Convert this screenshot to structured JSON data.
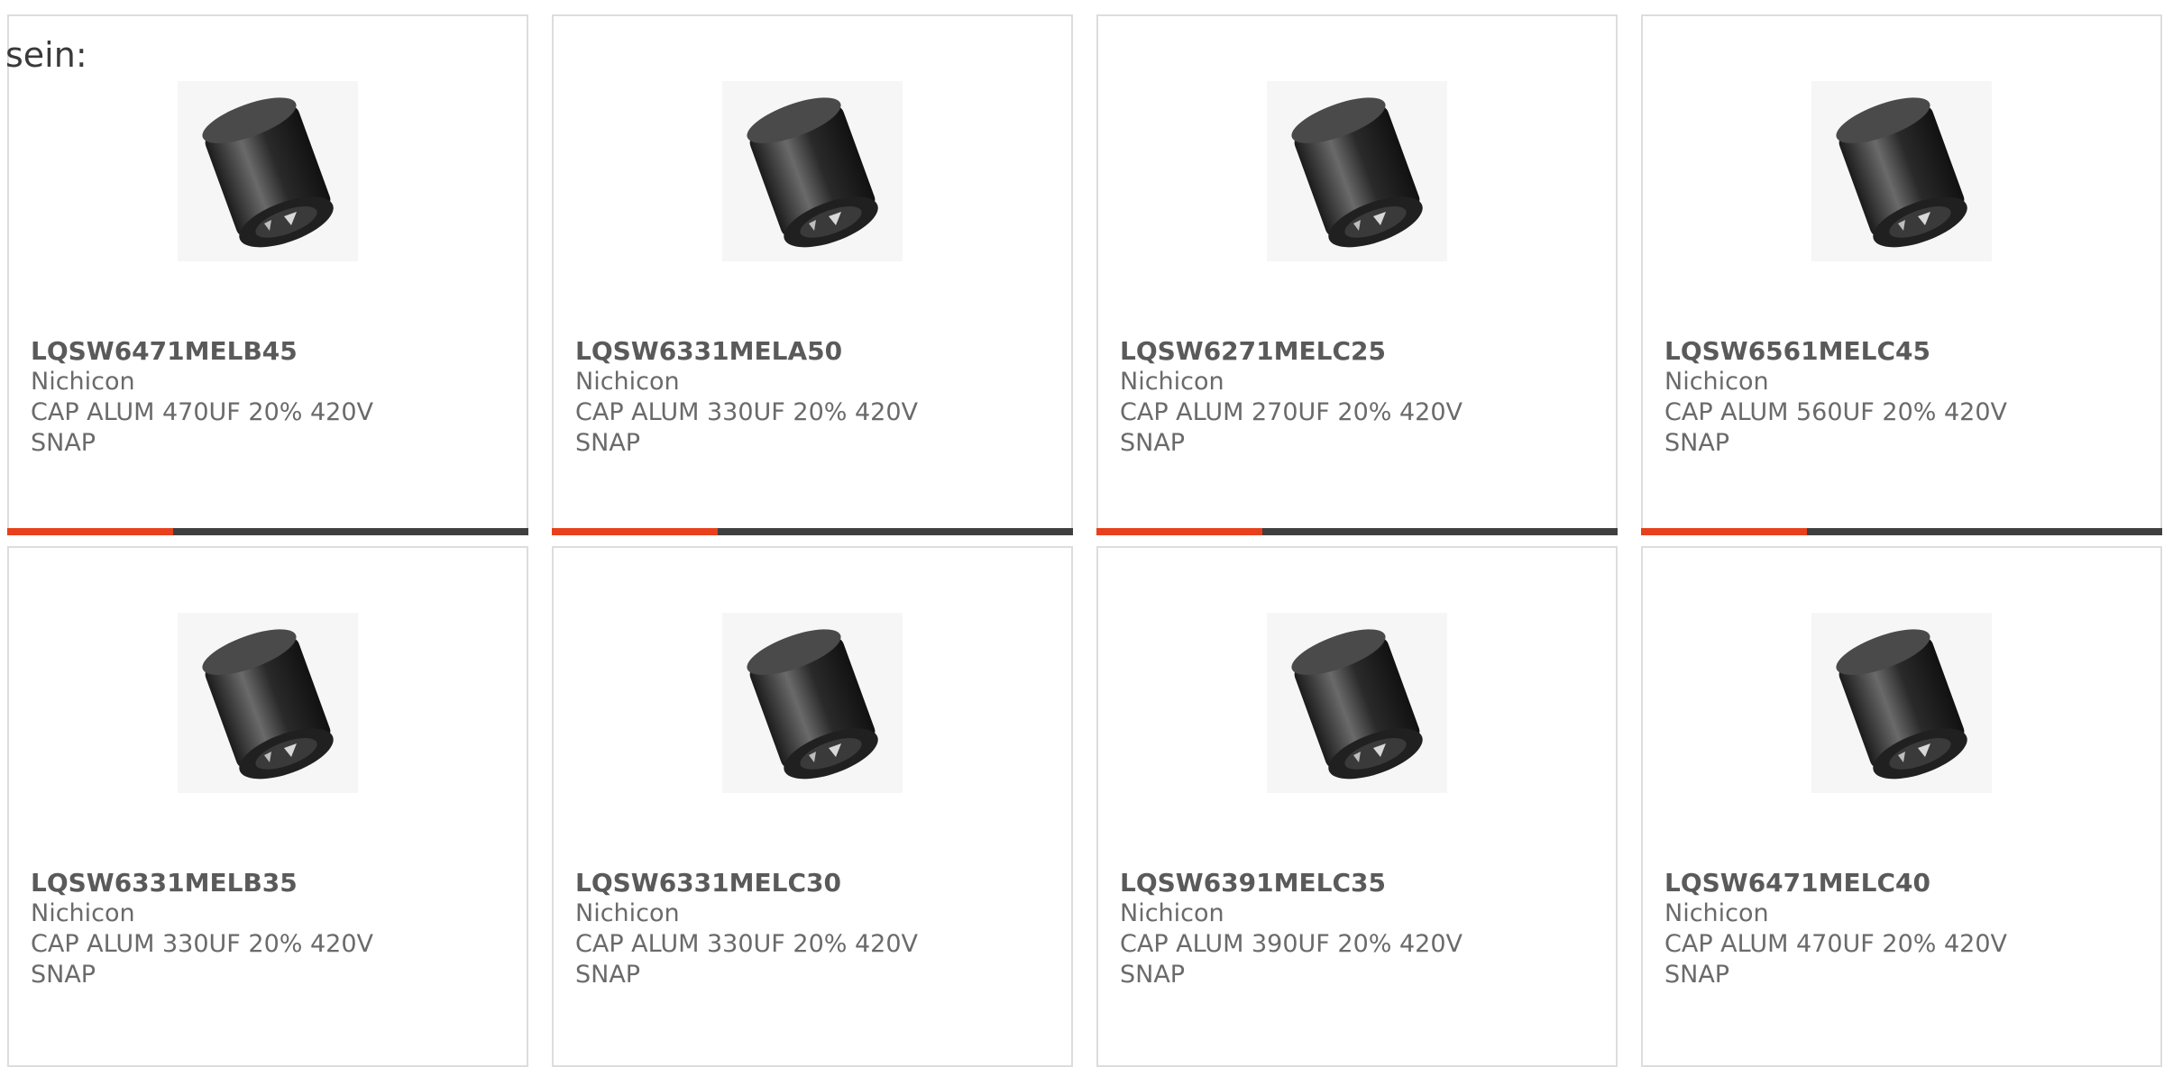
{
  "intro_text": "sein:",
  "colors": {
    "accent": "#e8401c",
    "bar": "#3f3f3f",
    "border": "#dddddd"
  },
  "products": [
    {
      "part": "LQSW6471MELB45",
      "manufacturer": "Nichicon",
      "desc1": "CAP ALUM 470UF 20% 420V",
      "desc2": "SNAP",
      "image": "capacitor-icon"
    },
    {
      "part": "LQSW6331MELA50",
      "manufacturer": "Nichicon",
      "desc1": "CAP ALUM 330UF 20% 420V",
      "desc2": "SNAP",
      "image": "capacitor-icon"
    },
    {
      "part": "LQSW6271MELC25",
      "manufacturer": "Nichicon",
      "desc1": "CAP ALUM 270UF 20% 420V",
      "desc2": "SNAP",
      "image": "capacitor-icon"
    },
    {
      "part": "LQSW6561MELC45",
      "manufacturer": "Nichicon",
      "desc1": "CAP ALUM 560UF 20% 420V",
      "desc2": "SNAP",
      "image": "capacitor-icon"
    },
    {
      "part": "LQSW6331MELB35",
      "manufacturer": "Nichicon",
      "desc1": "CAP ALUM 330UF 20% 420V",
      "desc2": "SNAP",
      "image": "capacitor-icon"
    },
    {
      "part": "LQSW6331MELC30",
      "manufacturer": "Nichicon",
      "desc1": "CAP ALUM 330UF 20% 420V",
      "desc2": "SNAP",
      "image": "capacitor-icon"
    },
    {
      "part": "LQSW6391MELC35",
      "manufacturer": "Nichicon",
      "desc1": "CAP ALUM 390UF 20% 420V",
      "desc2": "SNAP",
      "image": "capacitor-icon"
    },
    {
      "part": "LQSW6471MELC40",
      "manufacturer": "Nichicon",
      "desc1": "CAP ALUM 470UF 20% 420V",
      "desc2": "SNAP",
      "image": "capacitor-icon"
    }
  ]
}
